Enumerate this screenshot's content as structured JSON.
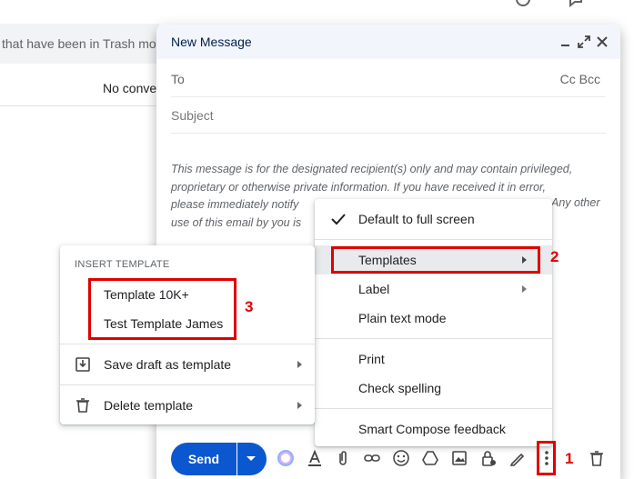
{
  "background": {
    "trash_banner": "that have been in Trash mo",
    "empty_state": "No conve"
  },
  "compose": {
    "title": "New Message",
    "to_label": "To",
    "cc_bcc": "Cc Bcc",
    "subject_placeholder": "Subject",
    "disclaimer_lines": [
      "This message is for the designated recipient(s) only and may contain privileged,",
      "proprietary or otherwise private information. If you have received it in error,",
      "please immediately notify",
      "use of this email by you is"
    ],
    "disclaimer_right": "Any other",
    "send_label": "Send",
    "toolbar_icons": [
      "color-picker-icon",
      "text-format-icon",
      "attach-icon",
      "link-icon",
      "emoji-icon",
      "drive-icon",
      "photo-icon",
      "confidential-lock-icon",
      "signature-pen-icon",
      "more-options-icon",
      "discard-trash-icon"
    ]
  },
  "more_menu": {
    "items": [
      {
        "label": "Default to full screen",
        "checked": true
      },
      {
        "label": "Templates",
        "submenu": true
      },
      {
        "label": "Label",
        "submenu": true
      },
      {
        "label": "Plain text mode"
      },
      {
        "label": "Print"
      },
      {
        "label": "Check spelling"
      },
      {
        "label": "Smart Compose feedback"
      }
    ]
  },
  "template_menu": {
    "header": "INSERT TEMPLATE",
    "templates": [
      "Template 10K+",
      "Test Template James"
    ],
    "save_draft": "Save draft as template",
    "delete_template": "Delete template"
  },
  "annotations": {
    "step1": "1",
    "step2": "2",
    "step3": "3",
    "color": "#e00000"
  },
  "colors": {
    "send_button": "#0b57d0",
    "header_bg": "#f2f6fc",
    "menu_highlight": "#e8eaed"
  }
}
